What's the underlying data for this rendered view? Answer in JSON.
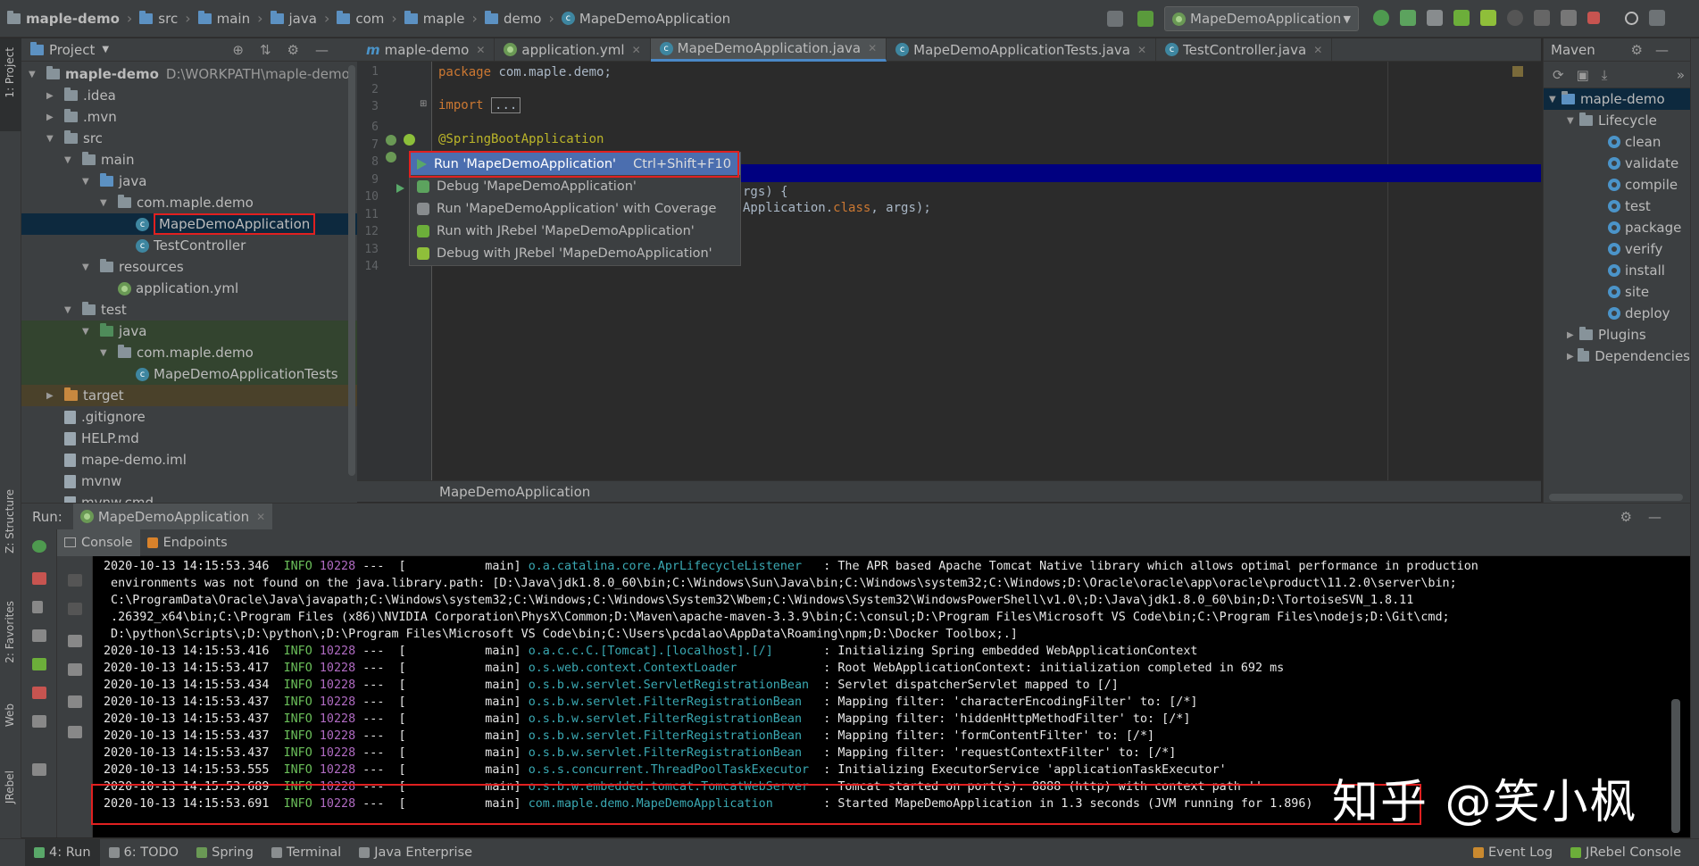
{
  "navbar": {
    "breadcrumbs": [
      "maple-demo",
      "src",
      "main",
      "java",
      "com",
      "maple",
      "demo",
      "MapeDemoApplication"
    ],
    "run_config": "MapeDemoApplication"
  },
  "left_strip": {
    "project": "1: Project",
    "structure": "Z: Structure",
    "favorites": "2: Favorites",
    "web": "Web",
    "jrebel": "JRebel"
  },
  "project": {
    "title": "Project",
    "tree": [
      {
        "label": "maple-demo",
        "sub": "D:\\WORKPATH\\maple-demo",
        "indent": 0,
        "arrow": "down",
        "icon": "folder"
      },
      {
        "label": ".idea",
        "indent": 1,
        "arrow": "right",
        "icon": "folder"
      },
      {
        "label": ".mvn",
        "indent": 1,
        "arrow": "right",
        "icon": "folder"
      },
      {
        "label": "src",
        "indent": 1,
        "arrow": "down",
        "icon": "folder"
      },
      {
        "label": "main",
        "indent": 2,
        "arrow": "down",
        "icon": "folder"
      },
      {
        "label": "java",
        "indent": 3,
        "arrow": "down",
        "icon": "folder-blue"
      },
      {
        "label": "com.maple.demo",
        "indent": 4,
        "arrow": "down",
        "icon": "package"
      },
      {
        "label": "MapeDemoApplication",
        "indent": 5,
        "arrow": "",
        "icon": "class",
        "selected": true
      },
      {
        "label": "TestController",
        "indent": 5,
        "arrow": "",
        "icon": "class"
      },
      {
        "label": "resources",
        "indent": 3,
        "arrow": "down",
        "icon": "folder"
      },
      {
        "label": "application.yml",
        "indent": 4,
        "arrow": "",
        "icon": "spring"
      },
      {
        "label": "test",
        "indent": 2,
        "arrow": "down",
        "icon": "folder"
      },
      {
        "label": "java",
        "indent": 3,
        "arrow": "down",
        "icon": "folder-green",
        "test": true
      },
      {
        "label": "com.maple.demo",
        "indent": 4,
        "arrow": "down",
        "icon": "package",
        "test": true
      },
      {
        "label": "MapeDemoApplicationTests",
        "indent": 5,
        "arrow": "",
        "icon": "class",
        "test": true
      },
      {
        "label": "target",
        "indent": 1,
        "arrow": "right",
        "icon": "folder-orange",
        "target": true
      },
      {
        "label": ".gitignore",
        "indent": 1,
        "arrow": "",
        "icon": "file"
      },
      {
        "label": "HELP.md",
        "indent": 1,
        "arrow": "",
        "icon": "file"
      },
      {
        "label": "mape-demo.iml",
        "indent": 1,
        "arrow": "",
        "icon": "file"
      },
      {
        "label": "mvnw",
        "indent": 1,
        "arrow": "",
        "icon": "file"
      },
      {
        "label": "mvnw.cmd",
        "indent": 1,
        "arrow": "",
        "icon": "file"
      }
    ]
  },
  "tabs": [
    {
      "label": "maple-demo",
      "icon": "m"
    },
    {
      "label": "application.yml",
      "icon": "spring"
    },
    {
      "label": "MapeDemoApplication.java",
      "icon": "class",
      "active": true
    },
    {
      "label": "MapeDemoApplicationTests.java",
      "icon": "class"
    },
    {
      "label": "TestController.java",
      "icon": "class"
    }
  ],
  "editor": {
    "line_numbers": [
      "1",
      "2",
      "3",
      "6",
      "7",
      "8",
      "9",
      "10",
      "11",
      "12",
      "13",
      "14"
    ],
    "line1_kw": "package",
    "line1_rest": " com.maple.demo;",
    "line3_kw": "import",
    "line3_fold": "...",
    "line6": "@SpringBootApplication",
    "line9_tail": "rgs) {",
    "line10_tail_a": "Application.",
    "line10_tail_kw": "class",
    "line10_tail_b": ", args);"
  },
  "popup": {
    "items": [
      {
        "label": "Run 'MapeDemoApplication'",
        "shortcut": "Ctrl+Shift+F10",
        "highlight": true
      },
      {
        "label": "Debug 'MapeDemoApplication'",
        "shortcut": ""
      },
      {
        "label": "Run 'MapeDemoApplication' with Coverage",
        "shortcut": ""
      },
      {
        "label": "Run with JRebel 'MapeDemoApplication'",
        "shortcut": ""
      },
      {
        "label": "Debug with JRebel 'MapeDemoApplication'",
        "shortcut": ""
      }
    ]
  },
  "editor_breadcrumb": "MapeDemoApplication",
  "maven": {
    "title": "Maven",
    "project": "maple-demo",
    "lifecycle": "Lifecycle",
    "goals": [
      "clean",
      "validate",
      "compile",
      "test",
      "package",
      "verify",
      "install",
      "site",
      "deploy"
    ],
    "plugins": "Plugins",
    "dependencies": "Dependencies"
  },
  "run": {
    "label": "Run:",
    "config": "MapeDemoApplication",
    "subtabs": [
      "Console",
      "Endpoints"
    ]
  },
  "console": {
    "lines": [
      {
        "ts": "2020-10-13 14:15:53.346",
        "level": "INFO",
        "pid": "10228",
        "thread": "---  [           main]",
        "logger": "o.a.catalina.core.AprLifecycleListener  ",
        "msg": " : The APR based Apache Tomcat Native library which allows optimal performance in production"
      },
      {
        "wrap": " environments was not found on the java.library.path: [D:\\Java\\jdk1.8.0_60\\bin;C:\\Windows\\Sun\\Java\\bin;C:\\Windows\\system32;C:\\Windows;D:\\Oracle\\oracle\\app\\oracle\\product\\11.2.0\\server\\bin;"
      },
      {
        "wrap": " C:\\ProgramData\\Oracle\\Java\\javapath;C:\\Windows\\system32;C:\\Windows;C:\\Windows\\System32\\Wbem;C:\\Windows\\System32\\WindowsPowerShell\\v1.0\\;D:\\Java\\jdk1.8.0_60\\bin;D:\\TortoiseSVN_1.8.11"
      },
      {
        "wrap": " .26392_x64\\bin;C:\\Program Files (x86)\\NVIDIA Corporation\\PhysX\\Common;D:\\Maven\\apache-maven-3.3.9\\bin;C:\\consul;D:\\Program Files\\Microsoft VS Code\\bin;C:\\Program Files\\nodejs;D:\\Git\\cmd;"
      },
      {
        "wrap": " D:\\python\\Scripts\\;D:\\python\\;D:\\Program Files\\Microsoft VS Code\\bin;C:\\Users\\pcdalao\\AppData\\Roaming\\npm;D:\\Docker Toolbox;.]"
      },
      {
        "ts": "2020-10-13 14:15:53.416",
        "level": "INFO",
        "pid": "10228",
        "thread": "---  [           main]",
        "logger": "o.a.c.c.C.[Tomcat].[localhost].[/]      ",
        "msg": " : Initializing Spring embedded WebApplicationContext"
      },
      {
        "ts": "2020-10-13 14:15:53.417",
        "level": "INFO",
        "pid": "10228",
        "thread": "---  [           main]",
        "logger": "o.s.web.context.ContextLoader           ",
        "msg": " : Root WebApplicationContext: initialization completed in 692 ms"
      },
      {
        "ts": "2020-10-13 14:15:53.434",
        "level": "INFO",
        "pid": "10228",
        "thread": "---  [           main]",
        "logger": "o.s.b.w.servlet.ServletRegistrationBean ",
        "msg": " : Servlet dispatcherServlet mapped to [/]"
      },
      {
        "ts": "2020-10-13 14:15:53.437",
        "level": "INFO",
        "pid": "10228",
        "thread": "---  [           main]",
        "logger": "o.s.b.w.servlet.FilterRegistrationBean  ",
        "msg": " : Mapping filter: 'characterEncodingFilter' to: [/*]"
      },
      {
        "ts": "2020-10-13 14:15:53.437",
        "level": "INFO",
        "pid": "10228",
        "thread": "---  [           main]",
        "logger": "o.s.b.w.servlet.FilterRegistrationBean  ",
        "msg": " : Mapping filter: 'hiddenHttpMethodFilter' to: [/*]"
      },
      {
        "ts": "2020-10-13 14:15:53.437",
        "level": "INFO",
        "pid": "10228",
        "thread": "---  [           main]",
        "logger": "o.s.b.w.servlet.FilterRegistrationBean  ",
        "msg": " : Mapping filter: 'formContentFilter' to: [/*]"
      },
      {
        "ts": "2020-10-13 14:15:53.437",
        "level": "INFO",
        "pid": "10228",
        "thread": "---  [           main]",
        "logger": "o.s.b.w.servlet.FilterRegistrationBean  ",
        "msg": " : Mapping filter: 'requestContextFilter' to: [/*]"
      },
      {
        "ts": "2020-10-13 14:15:53.555",
        "level": "INFO",
        "pid": "10228",
        "thread": "---  [           main]",
        "logger": "o.s.s.concurrent.ThreadPoolTaskExecutor ",
        "msg": " : Initializing ExecutorService 'applicationTaskExecutor'"
      },
      {
        "ts": "2020-10-13 14:15:53.689",
        "level": "INFO",
        "pid": "10228",
        "thread": "---  [           main]",
        "logger": "o.s.b.w.embedded.tomcat.TomcatWebServer ",
        "msg": " : Tomcat started on port(s): 8888 (http) with context path ''"
      },
      {
        "ts": "2020-10-13 14:15:53.691",
        "level": "INFO",
        "pid": "10228",
        "thread": "---  [           main]",
        "logger": "com.maple.demo.MapeDemoApplication      ",
        "msg": " : Started MapeDemoApplication in 1.3 seconds (JVM running for 1.896)"
      }
    ]
  },
  "watermark": "知乎 @笑小枫",
  "bottombar": [
    "4: Run",
    "6: TODO",
    "Spring",
    "Terminal",
    "Java Enterprise"
  ],
  "bottombar_right": [
    "Event Log",
    "JRebel Console"
  ],
  "colors": {
    "accent": "#4b6eaf",
    "highlight_box": "#e02020",
    "current_line": "#000080"
  }
}
